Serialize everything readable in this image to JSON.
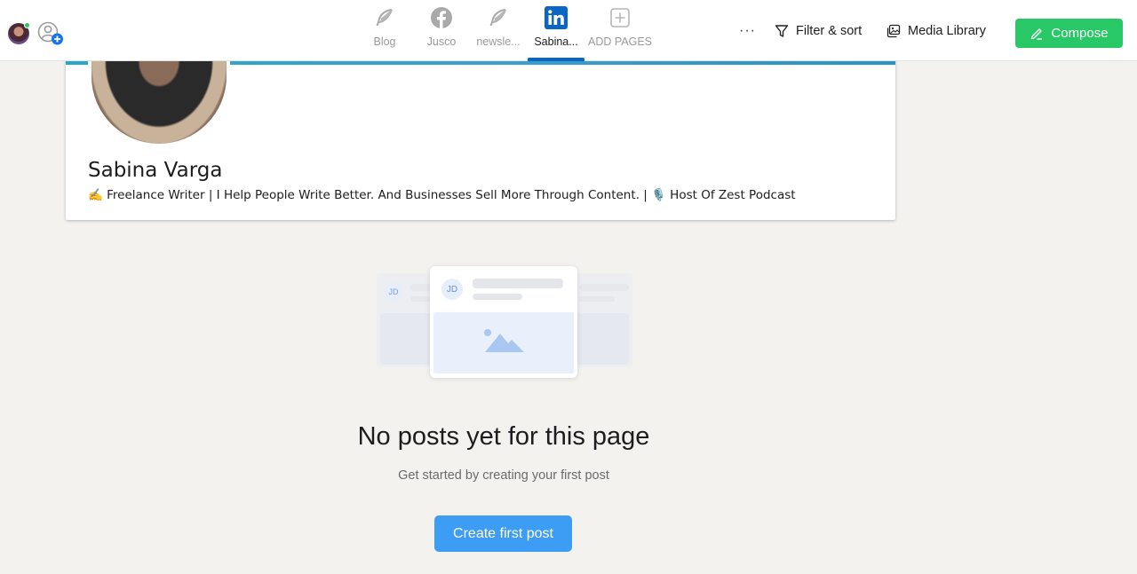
{
  "header": {
    "pages": [
      {
        "label": "Blog",
        "icon": "feather-icon"
      },
      {
        "label": "Jusco",
        "icon": "facebook-icon"
      },
      {
        "label": "newsle...",
        "icon": "feather-icon"
      },
      {
        "label": "Sabina...",
        "icon": "linkedin-icon",
        "active": true
      },
      {
        "label": "ADD PAGES",
        "icon": "add-square-icon"
      }
    ],
    "more_label": "···",
    "filter_label": "Filter & sort",
    "media_label": "Media Library",
    "compose_label": "Compose"
  },
  "profile": {
    "name": "Sabina Varga",
    "headline": "✍️ Freelance Writer | I Help People Write Better. And Businesses Sell More Through Content. | 🎙️ Host Of Zest Podcast"
  },
  "illustration": {
    "avatar_initials": "JD"
  },
  "empty_state": {
    "title": "No posts yet for this page",
    "subtitle": "Get started by creating your first post",
    "button_label": "Create first post"
  },
  "colors": {
    "compose": "#28c867",
    "linkedin": "#0a66c2",
    "primary_button": "#3d9cf4",
    "background": "#f3f2ef"
  }
}
